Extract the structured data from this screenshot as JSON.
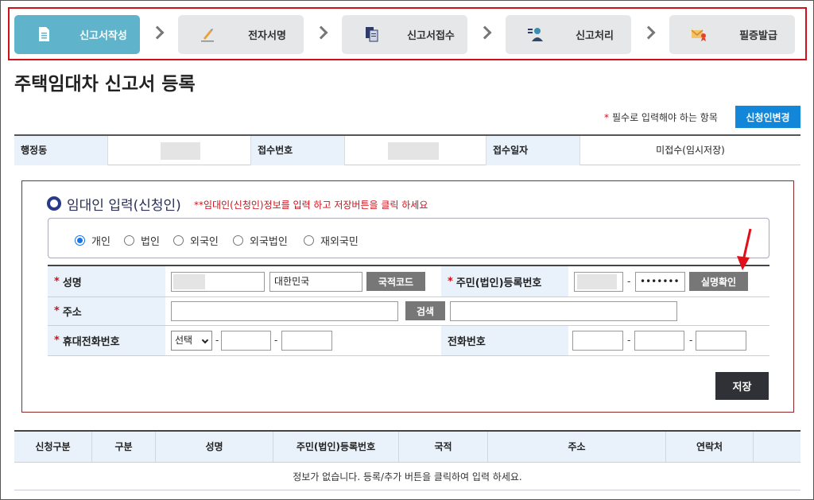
{
  "steps": [
    {
      "label": "신고서작성",
      "icon": "document-icon",
      "active": true
    },
    {
      "label": "전자서명",
      "icon": "pen-icon",
      "active": false
    },
    {
      "label": "신고서접수",
      "icon": "files-icon",
      "active": false
    },
    {
      "label": "신고처리",
      "icon": "person-icon",
      "active": false
    },
    {
      "label": "필증발급",
      "icon": "certificate-icon",
      "active": false
    }
  ],
  "page_title": "주택임대차 신고서 등록",
  "required_note": {
    "star": "*",
    "text": "필수로 입력해야 하는 항목"
  },
  "change_applicant_button": "신청인변경",
  "info": {
    "admin_dong_label": "행정동",
    "receipt_no_label": "접수번호",
    "receipt_date_label": "접수일자",
    "receipt_date_value": "미접수(임시저장)"
  },
  "landlord": {
    "title": "임대인 입력(신청인)",
    "note": "**임대인(신청인)정보를 입력 하고 저장버튼을 클릭 하세요",
    "types": [
      "개인",
      "법인",
      "외국인",
      "외국법인",
      "재외국민"
    ],
    "selected_type": "개인",
    "fields": {
      "name_label": "성명",
      "nationality_value": "대한민국",
      "nation_code_button": "국적코드",
      "resident_no_label": "주민(법인)등록번호",
      "resident_no_masked": "•••••••",
      "verify_button": "실명확인",
      "address_label": "주소",
      "search_button": "검색",
      "mobile_label": "휴대전화번호",
      "mobile_select": "선택",
      "phone_label": "전화번호",
      "dash": "-",
      "req": "*"
    },
    "save_button": "저장"
  },
  "list": {
    "headers": [
      "신청구분",
      "구분",
      "성명",
      "주민(법인)등록번호",
      "국적",
      "주소",
      "연락처"
    ],
    "empty_message": "정보가 없습니다.  등록/추가 버튼을 클릭하여 입력 하세요."
  },
  "colors": {
    "accent": "#5fb3cb",
    "primary_button": "#1286d8",
    "required": "#d0101a",
    "highlight_frame": "#d0101a"
  }
}
